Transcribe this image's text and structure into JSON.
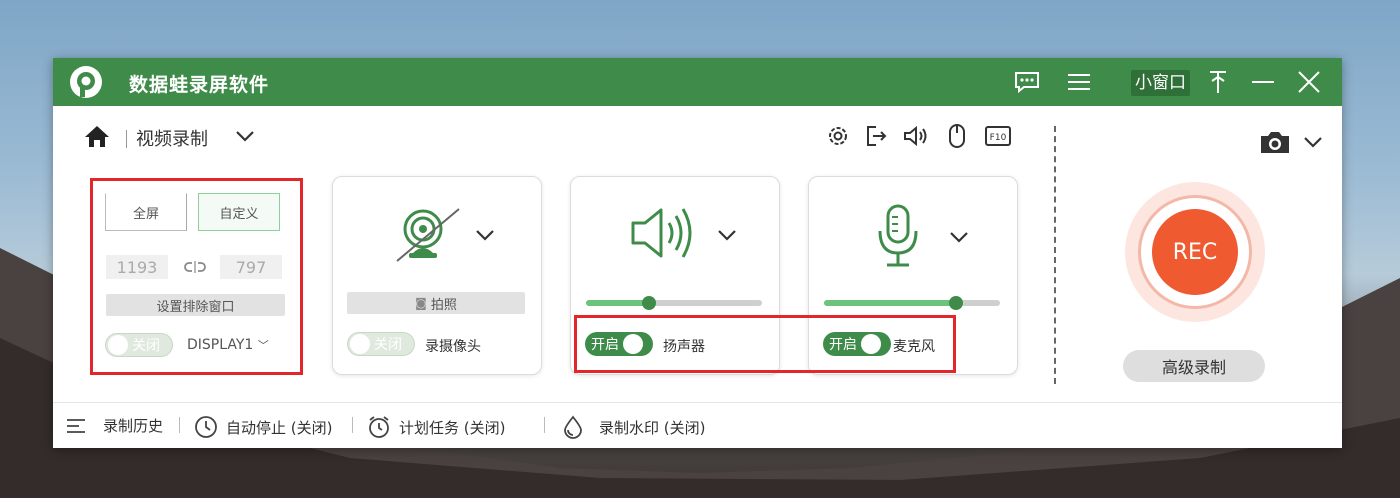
{
  "app": {
    "title": "数据蛙录屏软件",
    "mini_window": "小窗口"
  },
  "toolbar": {
    "mode": "视频录制"
  },
  "screen_card": {
    "fullscreen": "全屏",
    "custom": "自定义",
    "width": "1193",
    "height": "797",
    "exclude_window": "设置排除窗口",
    "toggle": "关闭",
    "display": "DISPLAY1"
  },
  "camera_card": {
    "photo": "拍照",
    "toggle": "关闭",
    "label": "录摄像头"
  },
  "speaker_card": {
    "toggle": "开启",
    "label": "扬声器",
    "volume": 0.36
  },
  "mic_card": {
    "toggle": "开启",
    "label": "麦克风",
    "volume": 0.75
  },
  "rec": {
    "label": "REC",
    "advanced": "高级录制"
  },
  "footer": {
    "history": "录制历史",
    "auto_stop": "自动停止 (关闭)",
    "schedule": "计划任务 (关闭)",
    "watermark": "录制水印 (关闭)"
  },
  "colors": {
    "brand": "#3f8c4a",
    "rec": "#ef5a30",
    "highlight": "#e3262b"
  }
}
